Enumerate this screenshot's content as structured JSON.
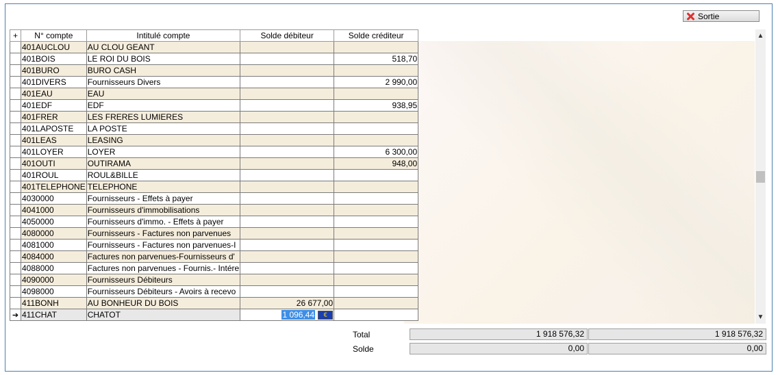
{
  "toolbar": {
    "exit_label": "Sortie"
  },
  "table": {
    "columns": [
      "N° compte",
      "Intitulé compte",
      "Solde débiteur",
      "Solde créditeur"
    ],
    "rows": [
      {
        "account": "401AUCLOU",
        "label": "AU CLOU GEANT",
        "debit": "",
        "credit": ""
      },
      {
        "account": "401BOIS",
        "label": "LE ROI DU BOIS",
        "debit": "",
        "credit": "518,70"
      },
      {
        "account": "401BURO",
        "label": "BURO CASH",
        "debit": "",
        "credit": ""
      },
      {
        "account": "401DIVERS",
        "label": "Fournisseurs Divers",
        "debit": "",
        "credit": "2 990,00"
      },
      {
        "account": "401EAU",
        "label": "EAU",
        "debit": "",
        "credit": ""
      },
      {
        "account": "401EDF",
        "label": "EDF",
        "debit": "",
        "credit": "938,95"
      },
      {
        "account": "401FRER",
        "label": "LES FRERES LUMIERES",
        "debit": "",
        "credit": ""
      },
      {
        "account": "401LAPOSTE",
        "label": "LA POSTE",
        "debit": "",
        "credit": ""
      },
      {
        "account": "401LEAS",
        "label": "LEASING",
        "debit": "",
        "credit": ""
      },
      {
        "account": "401LOYER",
        "label": "LOYER",
        "debit": "",
        "credit": "6 300,00"
      },
      {
        "account": "401OUTI",
        "label": "OUTIRAMA",
        "debit": "",
        "credit": "948,00"
      },
      {
        "account": "401ROUL",
        "label": "ROUL&BILLE",
        "debit": "",
        "credit": ""
      },
      {
        "account": "401TELEPHONE",
        "label": "TELEPHONE",
        "debit": "",
        "credit": ""
      },
      {
        "account": "4030000",
        "label": "Fournisseurs - Effets à payer",
        "debit": "",
        "credit": ""
      },
      {
        "account": "4041000",
        "label": "Fournisseurs d'immobilisations",
        "debit": "",
        "credit": ""
      },
      {
        "account": "4050000",
        "label": "Fournisseurs d'immo. - Effets à payer",
        "debit": "",
        "credit": ""
      },
      {
        "account": "4080000",
        "label": "Fournisseurs - Factures non parvenues",
        "debit": "",
        "credit": ""
      },
      {
        "account": "4081000",
        "label": "Fournisseurs - Factures non parvenues-I",
        "debit": "",
        "credit": ""
      },
      {
        "account": "4084000",
        "label": "Factures non parvenues-Fournisseurs d'",
        "debit": "",
        "credit": ""
      },
      {
        "account": "4088000",
        "label": "Factures non parvenues - Fournis.- Intére",
        "debit": "",
        "credit": ""
      },
      {
        "account": "4090000",
        "label": "Fournisseurs Débiteurs",
        "debit": "",
        "credit": ""
      },
      {
        "account": "4098000",
        "label": "Fournisseurs Débiteurs - Avoirs à recevo",
        "debit": "",
        "credit": ""
      },
      {
        "account": "411BONH",
        "label": "AU BONHEUR DU BOIS",
        "debit": "26 677,00",
        "credit": ""
      }
    ],
    "current_row": {
      "account": "411CHAT",
      "label": "CHATOT",
      "debit": "1 096,44",
      "credit": "",
      "currency_icon": "euro-flag-icon"
    }
  },
  "totals": {
    "total_label": "Total",
    "total_debit": "1 918 576,32",
    "total_credit": "1 918 576,32",
    "balance_label": "Solde",
    "balance_debit": "0,00",
    "balance_credit": "0,00"
  }
}
